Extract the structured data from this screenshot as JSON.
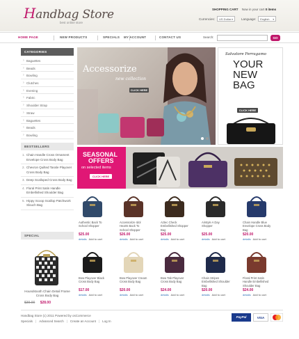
{
  "header": {
    "logo_h": "H",
    "logo_rest": "andbag Store",
    "tagline": "best online store",
    "cart_title": "SHOPPING CART",
    "cart_text": "Now in your cart",
    "cart_count": "0 items",
    "currencies_label": "Currencies:",
    "currency_value": "US Dollar",
    "language_label": "Language:",
    "language_value": "English"
  },
  "nav": {
    "items": [
      "HOME PAGE",
      "NEW PRODUCTS",
      "SPECIALS",
      "MY ACCOUNT",
      "CONTACT US"
    ],
    "search_label": "Search:",
    "search_button": "GO"
  },
  "sidebar": {
    "categories_title": "CATEGORIES",
    "categories": [
      "Baguettes",
      "Beads",
      "Bowling",
      "Clutches",
      "Evening",
      "Fabric",
      "Shoulder Strap",
      "Straw",
      "Baguettes",
      "Beads",
      "Bowling"
    ],
    "bestsellers_title": "BESTSELLERS",
    "bestsellers": [
      "Chain Handle Cross Ornament Envelope Cross Body Bag",
      "Chevron Quilted Tassle Playover Cross Body Bag",
      "Deep Scalloped Cross Body Bag",
      "Floral Print Satin Handle Embellished Shoulder Bag",
      "Hippy Scoop Scallop Patchwork Slouch Bag"
    ],
    "specials_title": "SPECIAL",
    "special_name": "Houndstooth Chain Detail Frame Cross Body Bag",
    "special_old": "$39.00",
    "special_new": "$28.00"
  },
  "banners": {
    "accessorize_title": "Accessorize",
    "accessorize_sub": "new collection",
    "accessorize_btn": "CLICK HERE",
    "ferragamo_brand": "Salvatore Ferragamo",
    "ferragamo_line1": "YOUR",
    "ferragamo_line2": "NEW",
    "ferragamo_line3": "BAG",
    "ferragamo_btn": "CLICK HERE",
    "seasonal_line1": "SEASONAL",
    "seasonal_line2": "OFFERS",
    "seasonal_line3": "on selected items",
    "seasonal_btn": "CLICK HERE"
  },
  "products": [
    {
      "name": "Authentic Back To School Shopper",
      "price": "$25.00"
    },
    {
      "name": "Accessorize Idol Hearts Back To School Shopper",
      "price": "$26.00"
    },
    {
      "name": "Aztec Check Embellished Shopper Bag",
      "price": "$25.00"
    },
    {
      "name": "Airstyle A Day Shopper",
      "price": "$25.00"
    },
    {
      "name": "Chain Handle Blue Envelope Cross Body Bag",
      "price": "$20.00"
    },
    {
      "name": "Bow Playover Black Cross Body Bag",
      "price": "$17.00"
    },
    {
      "name": "Bow Playover Cream Cross Body Bag",
      "price": "$20.00"
    },
    {
      "name": "Bow Tab Playover Cross Body Bag",
      "price": "$24.00"
    },
    {
      "name": "Chain Stripes Embellished Shoulder Bag",
      "price": "$20.00"
    },
    {
      "name": "Floral Print Satin Handle Embellished Shoulder Bag",
      "price": "$24.00"
    }
  ],
  "product_actions": {
    "details": "details",
    "add_to_cart": "Add to cart"
  },
  "footer": {
    "copyright": "Handbag Store (c) 2011 Powered by osCommerce",
    "links": [
      "Specials",
      "Advanced Search",
      "Create an Account",
      "Log In"
    ],
    "pay1": "PayPal",
    "pay2": "VISA"
  },
  "colors": {
    "accent": "#c0186b",
    "dark": "#5c5c5c"
  }
}
